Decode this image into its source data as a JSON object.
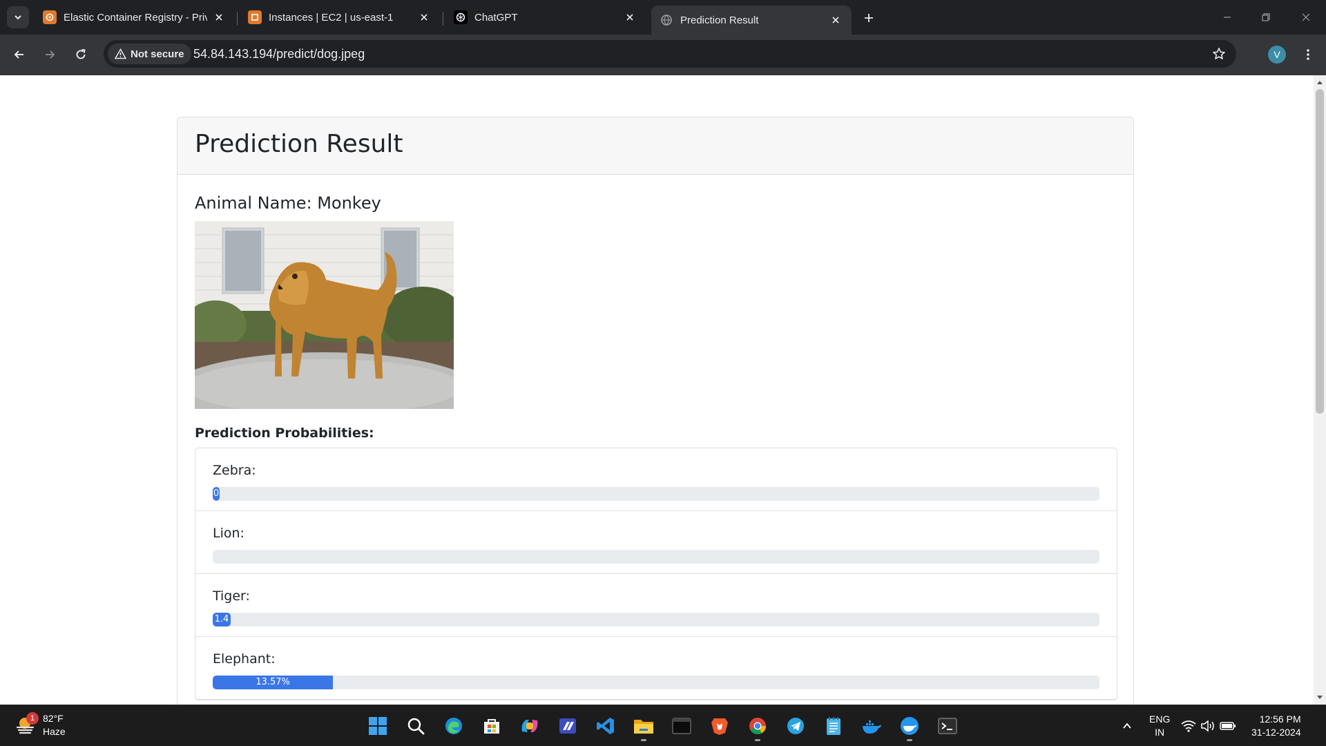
{
  "browser": {
    "tabs": [
      {
        "title": "Elastic Container Registry - Private",
        "icon": "aws-icon",
        "active": false
      },
      {
        "title": "Instances | EC2 | us-east-1",
        "icon": "aws-icon",
        "active": false
      },
      {
        "title": "ChatGPT",
        "icon": "chatgpt-icon",
        "active": false
      },
      {
        "title": "Prediction Result",
        "icon": "globe-icon",
        "active": true
      }
    ],
    "security_label": "Not secure",
    "url": "54.84.143.194/predict/dog.jpeg",
    "profile_initial": "V"
  },
  "page": {
    "header_title": "Prediction Result",
    "animal_name": "Animal Name: Monkey",
    "image_description": "dog photo",
    "probabilities_heading": "Prediction Probabilities:",
    "probabilities": [
      {
        "label": "Zebra:",
        "value_text": "0",
        "percent": 0
      },
      {
        "label": "Lion:",
        "value_text": "",
        "percent": 0
      },
      {
        "label": "Tiger:",
        "value_text": "1.4",
        "percent": 1.4
      },
      {
        "label": "Elephant:",
        "value_text": "13.57%",
        "percent": 13.57
      }
    ],
    "colors": {
      "bar_fill": "#3b76e6",
      "bar_track": "#e9ecef"
    }
  },
  "taskbar": {
    "weather": {
      "temp": "82°F",
      "condition": "Haze",
      "badge": "1"
    },
    "apps": [
      "windows-start-icon",
      "search-icon",
      "edge-icon",
      "microsoft-store-icon",
      "copilot-icon",
      "visual-studio-icon",
      "vscode-icon",
      "file-explorer-icon",
      "terminal-icon",
      "brave-icon",
      "chrome-icon",
      "telegram-icon",
      "notepad-icon",
      "docker-icon",
      "docker-icon",
      "terminal-icon"
    ],
    "language": {
      "line1": "ENG",
      "line2": "IN"
    },
    "time": "12:56 PM",
    "date": "31-12-2024"
  }
}
